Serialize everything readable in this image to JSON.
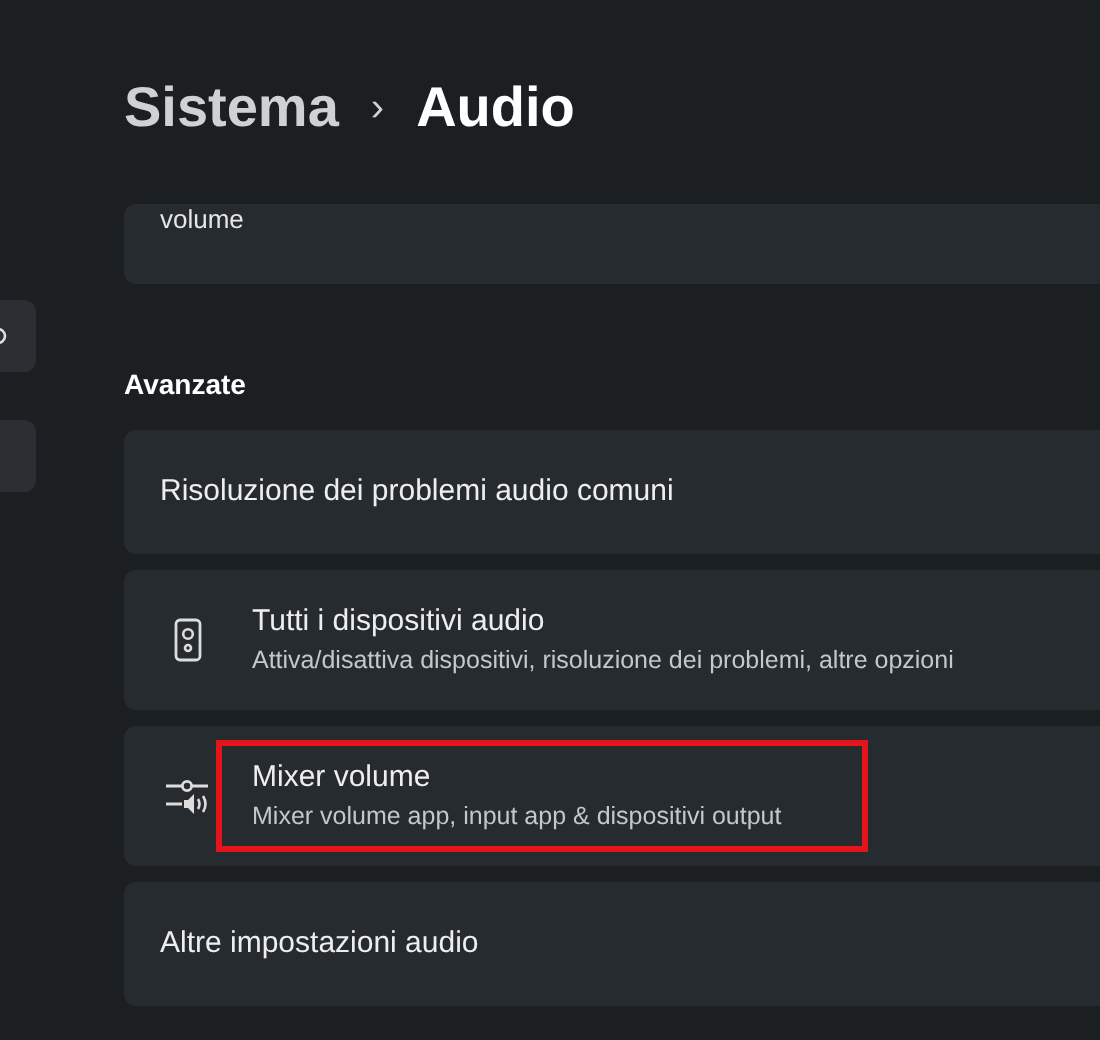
{
  "breadcrumb": {
    "parent": "Sistema",
    "separator": "›",
    "current": "Audio"
  },
  "partial_card": {
    "title": "volume"
  },
  "section_title": "Avanzate",
  "items": [
    {
      "kind": "plain",
      "title": "Risoluzione dei problemi audio comuni",
      "highlighted": false
    },
    {
      "kind": "speaker",
      "title": "Tutti i dispositivi audio",
      "subtitle": "Attiva/disattiva dispositivi, risoluzione dei problemi, altre opzioni",
      "highlighted": false
    },
    {
      "kind": "mixer",
      "title": "Mixer volume",
      "subtitle": "Mixer volume app, input app & dispositivi output",
      "highlighted": true
    },
    {
      "kind": "plain",
      "title": "Altre impostazioni audio",
      "highlighted": false
    }
  ]
}
